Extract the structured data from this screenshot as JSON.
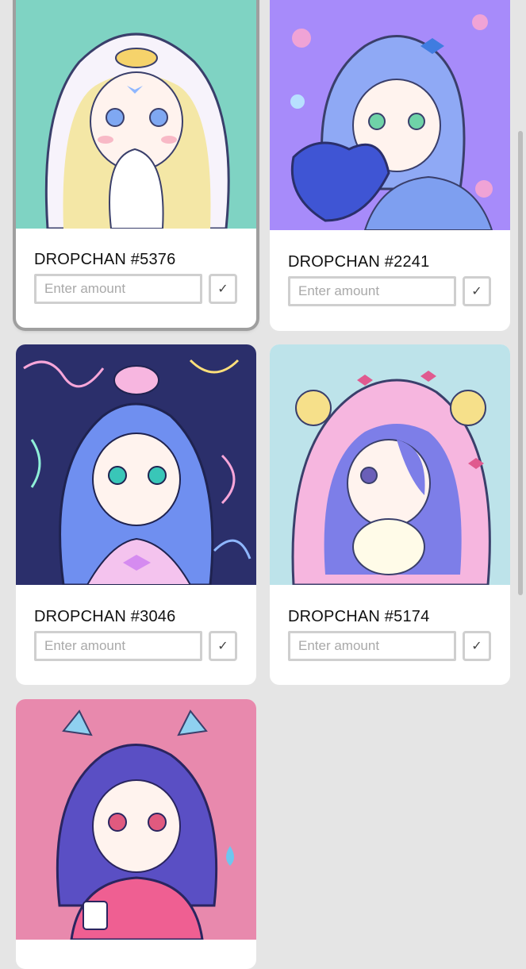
{
  "colors": {
    "page_bg": "#e5e5e5",
    "card_bg": "#ffffff",
    "input_border": "#cfcfcf",
    "selected_outline": "#9f9f9f"
  },
  "nfts": [
    {
      "title": "DROPCHAN #5376",
      "amount_placeholder": "Enter amount",
      "confirm_icon": "checkmark-icon",
      "confirm_glyph": "✓",
      "selected": true,
      "art_bg": "#7fd3c3",
      "art_theme": "blonde-girl-white-hood"
    },
    {
      "title": "DROPCHAN #2241",
      "amount_placeholder": "Enter amount",
      "confirm_icon": "checkmark-icon",
      "confirm_glyph": "✓",
      "selected": false,
      "art_bg": "#a78bfa",
      "art_theme": "blue-hair-heart-balloon"
    },
    {
      "title": "DROPCHAN #3046",
      "amount_placeholder": "Enter amount",
      "confirm_icon": "checkmark-icon",
      "confirm_glyph": "✓",
      "selected": false,
      "art_bg": "#2b2f6b",
      "art_theme": "blue-hair-doodle-background"
    },
    {
      "title": "DROPCHAN #5174",
      "amount_placeholder": "Enter amount",
      "confirm_icon": "checkmark-icon",
      "confirm_glyph": "✓",
      "selected": false,
      "art_bg": "#bde3ea",
      "art_theme": "pink-sheep-hood"
    },
    {
      "title": "",
      "amount_placeholder": "",
      "selected": false,
      "art_bg": "#e889ad",
      "art_theme": "purple-hair-pink-jacket"
    }
  ]
}
